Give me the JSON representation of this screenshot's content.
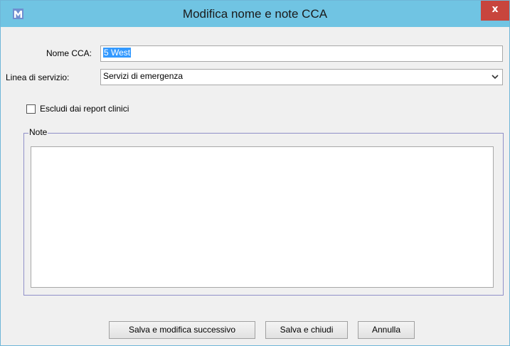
{
  "window": {
    "title": "Modifica nome e note CCA",
    "close_glyph": "x",
    "app_icon": "app-logo-icon"
  },
  "form": {
    "nome_label": "Nome CCA:",
    "nome_value": "5 West",
    "linea_label": "Linea di servizio:",
    "linea_value": "Servizi di emergenza",
    "checkbox_label": "Escludi dai report clinici",
    "checkbox_checked": false,
    "note_legend": "Note",
    "note_value": ""
  },
  "buttons": {
    "save_next": "Salva e modifica successivo",
    "save_close": "Salva e chiudi",
    "cancel": "Annulla"
  },
  "colors": {
    "titlebar": "#70c4e3",
    "close": "#c8453d",
    "selection": "#3399ff"
  }
}
